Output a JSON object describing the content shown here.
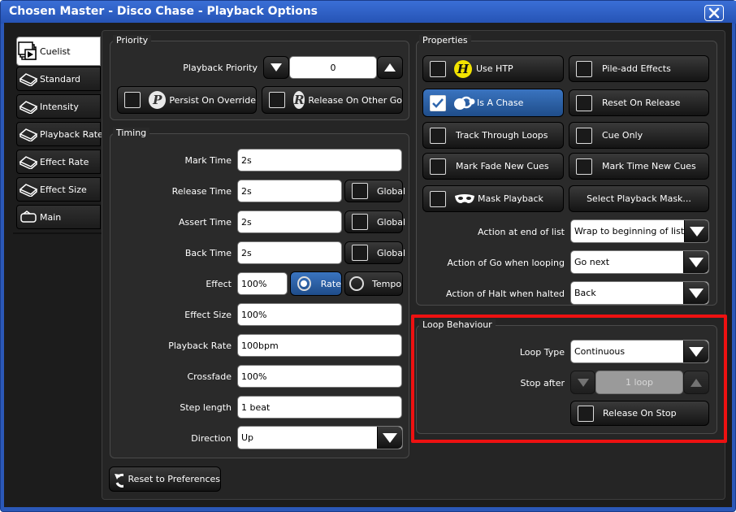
{
  "window": {
    "title": "Chosen Master - Disco Chase - Playback Options"
  },
  "tabs": [
    {
      "label": "Cuelist",
      "icon": "cuelist-icon",
      "active": true
    },
    {
      "label": "Standard",
      "icon": "fader-icon"
    },
    {
      "label": "Intensity",
      "icon": "fader-icon"
    },
    {
      "label": "Playback Rate",
      "icon": "fader-icon"
    },
    {
      "label": "Effect Rate",
      "icon": "fader-icon"
    },
    {
      "label": "Effect Size",
      "icon": "fader-icon"
    },
    {
      "label": "Main",
      "icon": "main-icon"
    }
  ],
  "priority": {
    "legend": "Priority",
    "playback_priority_label": "Playback Priority",
    "playback_priority_value": "0",
    "persist_on_override": "Persist On Override",
    "release_on_other_go": "Release On Other Go"
  },
  "timing": {
    "legend": "Timing",
    "mark_time": {
      "label": "Mark Time",
      "value": "2s"
    },
    "release_time": {
      "label": "Release Time",
      "value": "2s",
      "global": "Global"
    },
    "assert_time": {
      "label": "Assert Time",
      "value": "2s",
      "global": "Global"
    },
    "back_time": {
      "label": "Back Time",
      "value": "2s",
      "global": "Global"
    },
    "effect": {
      "label": "Effect",
      "value": "100%",
      "rate": "Rate",
      "tempo": "Tempo"
    },
    "effect_size": {
      "label": "Effect Size",
      "value": "100%"
    },
    "playback_rate": {
      "label": "Playback Rate",
      "value": "100bpm"
    },
    "crossfade": {
      "label": "Crossfade",
      "value": "100%"
    },
    "step_length": {
      "label": "Step length",
      "value": "1 beat"
    },
    "direction": {
      "label": "Direction",
      "value": "Up"
    }
  },
  "properties": {
    "legend": "Properties",
    "use_htp": "Use HTP",
    "pile_add_effects": "Pile-add Effects",
    "is_a_chase": "Is A Chase",
    "reset_on_release": "Reset On Release",
    "track_through_loops": "Track Through Loops",
    "cue_only": "Cue Only",
    "mark_fade_new_cues": "Mark Fade New Cues",
    "mark_time_new_cues": "Mark Time New Cues",
    "mask_playback": "Mask Playback",
    "select_playback_mask": "Select Playback Mask...",
    "action_end_label": "Action at end of list",
    "action_end_value": "Wrap to beginning of list",
    "action_go_label": "Action of Go when looping",
    "action_go_value": "Go next",
    "action_halt_label": "Action of Halt when halted",
    "action_halt_value": "Back"
  },
  "loop": {
    "legend": "Loop Behaviour",
    "loop_type_label": "Loop Type",
    "loop_type_value": "Continuous",
    "stop_after_label": "Stop after",
    "stop_after_value": "1 loop",
    "release_on_stop": "Release On Stop"
  },
  "footer": {
    "reset_label": "Reset to Preferences"
  },
  "colors": {
    "title_bar": "#2b58b8",
    "selected": "#2f66ad",
    "highlight": "#e11111",
    "badge_yellow": "#f2e300"
  }
}
